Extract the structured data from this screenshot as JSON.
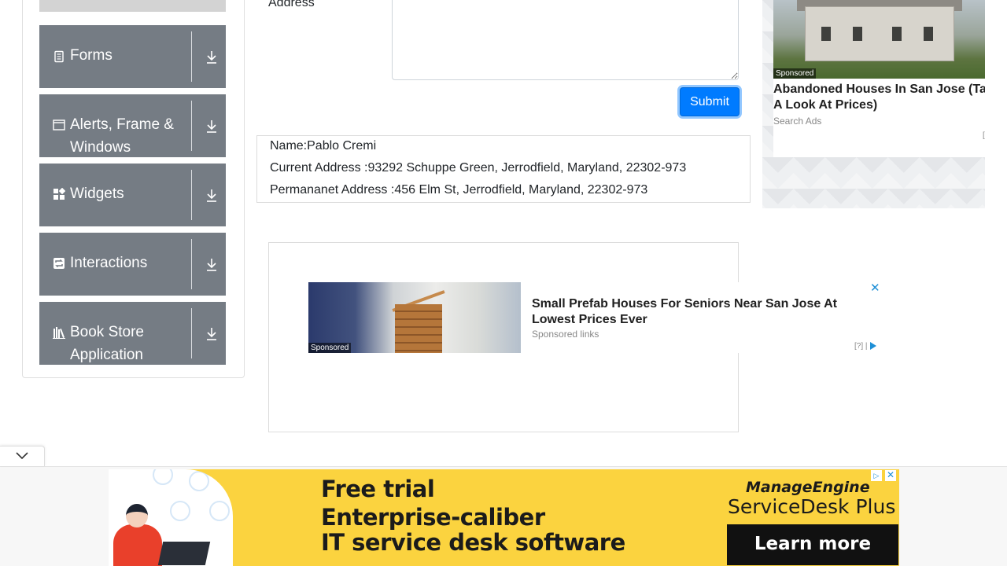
{
  "sidebar": {
    "groups": [
      {
        "label": "Forms",
        "icon": "form-icon"
      },
      {
        "label": "Alerts, Frame & Windows",
        "icon": "window-icon"
      },
      {
        "label": "Widgets",
        "icon": "widgets-icon"
      },
      {
        "label": "Interactions",
        "icon": "interactions-icon"
      },
      {
        "label": "Book Store Application",
        "icon": "book-icon"
      }
    ]
  },
  "form": {
    "permanent_address_label": "Address",
    "submit_label": "Submit"
  },
  "output": {
    "name": "Name:Pablo Cremi",
    "current_address": "Current Address :93292 Schuppe Green, Jerrodfield, Maryland, 22302-973",
    "permanent_address": "Permananet Address :456 Elm St, Jerrodfield, Maryland, 22302-973"
  },
  "right_ad": {
    "sponsored": "Sponsored",
    "title": "Abandoned Houses In San Jose (Take A Look At Prices)",
    "source": "Search Ads",
    "adchoice": "[?]"
  },
  "mid_ad": {
    "sponsored": "Sponsored",
    "title": "Small Prefab Houses For Seniors Near San Jose At Lowest Prices Ever",
    "source": "Sponsored links",
    "adchoice": "[?]",
    "close": "✕"
  },
  "banner": {
    "line1": "Free trial",
    "line2": "Enterprise-caliber",
    "line3": "IT service desk software",
    "brand_top": "ManageEngine",
    "brand_bottom": "ServiceDesk Plus",
    "cta": "Learn more",
    "adinfo": "▷",
    "close": "✕"
  },
  "colors": {
    "sidebar_group": "#757c84",
    "submit": "#007bff",
    "banner": "#fbd33f"
  }
}
